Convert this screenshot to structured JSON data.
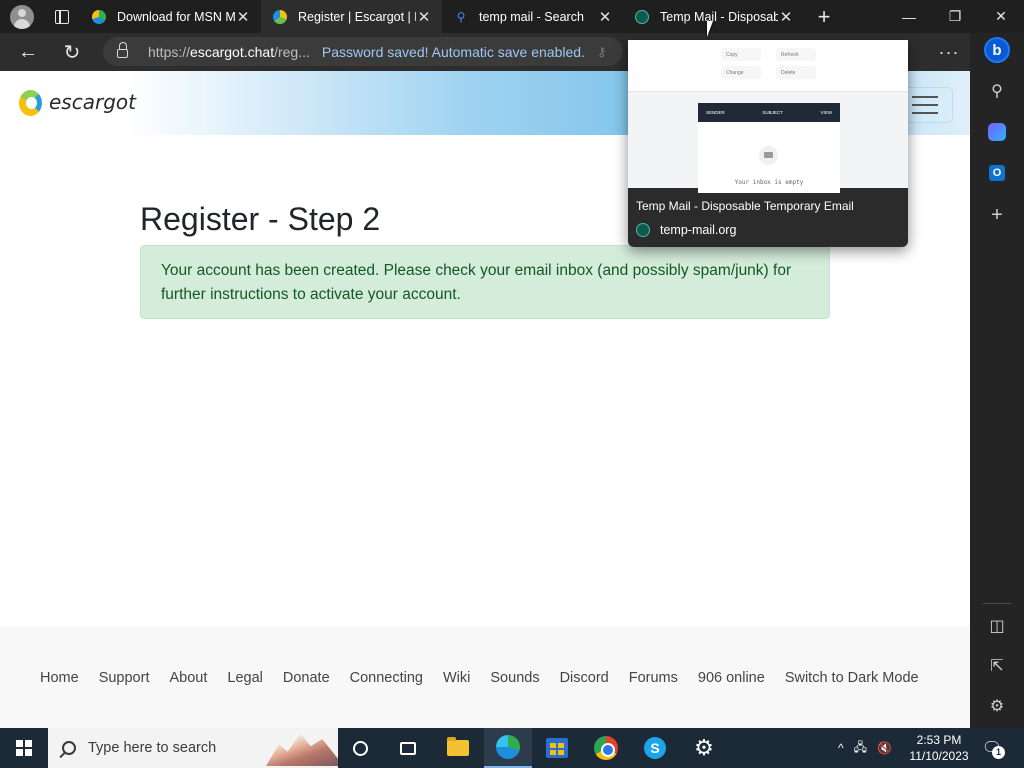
{
  "browser": {
    "tabs": [
      {
        "title": "Download for MSN M",
        "close": "✕"
      },
      {
        "title": "Register | Escargot | M",
        "close": "✕"
      },
      {
        "title": "temp mail - Search",
        "close": "✕"
      },
      {
        "title": "Temp Mail - Disposab",
        "close": "✕"
      }
    ],
    "new_tab": "+",
    "window_controls": {
      "minimize": "—",
      "restore": "❐",
      "close": "✕"
    }
  },
  "addressbar": {
    "back": "←",
    "refresh": "↻",
    "url_prefix": "https://",
    "url_host": "escargot.chat",
    "url_rest": "/reg...",
    "password_message": "Password saved! Automatic save enabled.",
    "more": "···"
  },
  "sidebar": {
    "bing": "b",
    "search": "⚲",
    "outlook": "O",
    "add": "+",
    "split": "◫",
    "external": "⇱",
    "settings": "⚙"
  },
  "site": {
    "name": "escargot",
    "page_title": "Register - Step 2",
    "alert_message": "Your account has been created. Please check your email inbox (and possibly spam/junk) for further instructions to activate your account.",
    "footer_links": [
      "Home",
      "Support",
      "About",
      "Legal",
      "Donate",
      "Connecting",
      "Wiki",
      "Sounds",
      "Discord",
      "Forums",
      "906 online",
      "Switch to Dark Mode"
    ]
  },
  "hovercard": {
    "preview_buttons": [
      "Copy",
      "Refresh",
      "Change",
      "Delete"
    ],
    "preview_columns": [
      "SENDER",
      "SUBJECT",
      "VIEW"
    ],
    "preview_empty": "Your inbox is empty",
    "title": "Temp Mail - Disposable Temporary Email",
    "site": "temp-mail.org"
  },
  "taskbar": {
    "search_placeholder": "Type here to search",
    "time": "2:53 PM",
    "date": "11/10/2023",
    "notification_count": "1",
    "tray_chevron": "^"
  }
}
